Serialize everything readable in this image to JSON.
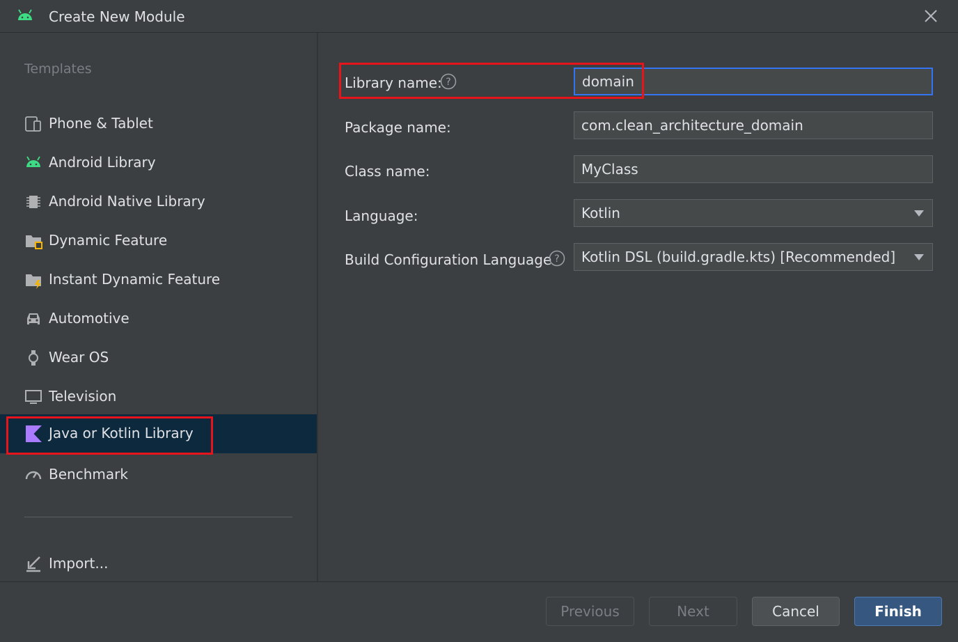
{
  "window": {
    "title": "Create New Module",
    "app_icon": "android-icon",
    "close_icon": "close-icon"
  },
  "sidebar": {
    "heading": "Templates",
    "items": [
      {
        "label": "Phone & Tablet",
        "icon": "phone-tablet-icon",
        "selected": false
      },
      {
        "label": "Android Library",
        "icon": "android-icon",
        "selected": false
      },
      {
        "label": "Android Native Library",
        "icon": "chip-icon",
        "selected": false
      },
      {
        "label": "Dynamic Feature",
        "icon": "folder-feature-icon",
        "selected": false
      },
      {
        "label": "Instant Dynamic Feature",
        "icon": "folder-lightning-icon",
        "selected": false
      },
      {
        "label": "Automotive",
        "icon": "car-icon",
        "selected": false
      },
      {
        "label": "Wear OS",
        "icon": "watch-icon",
        "selected": false
      },
      {
        "label": "Television",
        "icon": "tv-icon",
        "selected": false
      },
      {
        "label": "Java or Kotlin Library",
        "icon": "kotlin-icon",
        "selected": true
      },
      {
        "label": "Benchmark",
        "icon": "gauge-icon",
        "selected": false
      }
    ],
    "import": {
      "label": "Import...",
      "icon": "import-icon"
    }
  },
  "form": {
    "library_name": {
      "label": "Library name:",
      "value": "domain"
    },
    "package_name": {
      "label": "Package name:",
      "value": "com.clean_architecture_domain"
    },
    "class_name": {
      "label": "Class name:",
      "value": "MyClass"
    },
    "language": {
      "label": "Language:",
      "value": "Kotlin"
    },
    "build_config": {
      "label": "Build Configuration Language",
      "value": "Kotlin DSL (build.gradle.kts) [Recommended]"
    }
  },
  "buttons": {
    "previous": "Previous",
    "next": "Next",
    "cancel": "Cancel",
    "finish": "Finish"
  },
  "colors": {
    "background": "#3c3f41",
    "selection": "#0d293e",
    "highlight": "#e8141b",
    "accent": "#3574f0",
    "android_green": "#3ddc84",
    "kotlin_purple": "#a97bff"
  }
}
